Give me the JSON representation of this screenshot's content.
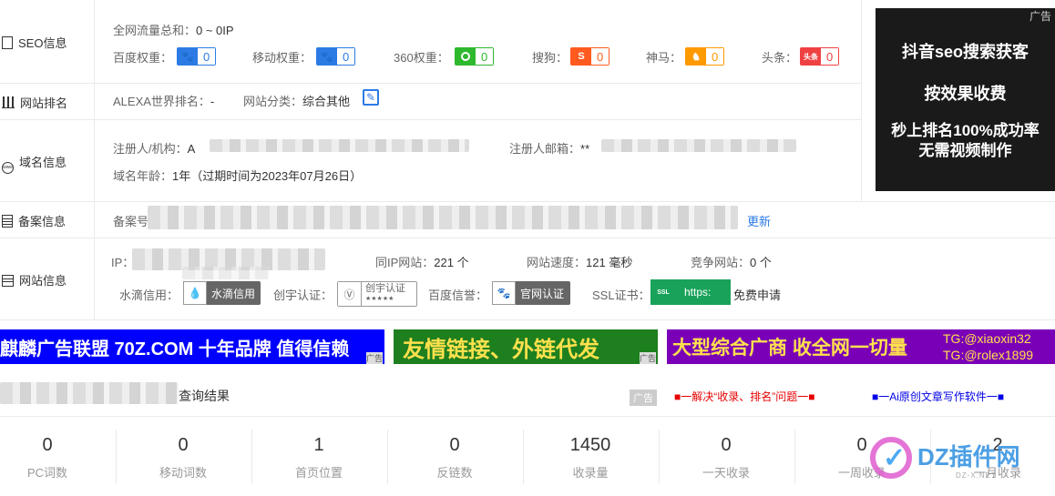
{
  "sections": {
    "seo": "SEO信息",
    "rank": "网站排名",
    "domain": "域名信息",
    "beian": "备案信息",
    "site": "网站信息"
  },
  "seo": {
    "traffic_label": "全网流量总和：",
    "traffic_value": "0 ~ 0IP",
    "baidu_label": "百度权重：",
    "baidu_value": "0",
    "mobile_label": "移动权重：",
    "mobile_value": "0",
    "s360_label": "360权重：",
    "s360_value": "0",
    "sogou_label": "搜狗：",
    "sogou_value": "0",
    "shenma_label": "神马：",
    "shenma_value": "0",
    "toutiao_label": "头条：",
    "toutiao_value": "0",
    "toutiao_icon_text": "头条"
  },
  "rank": {
    "alexa_label": "ALEXA世界排名：",
    "alexa_value": "-",
    "category_label": "网站分类：",
    "category_value": "综合其他"
  },
  "domain": {
    "registrant_label": "注册人/机构：",
    "registrant_value": "A",
    "email_label": "注册人邮箱：",
    "email_value": "**",
    "age_label": "域名年龄：",
    "age_value": "1年（过期时间为2023年07月26日）"
  },
  "beian": {
    "label": "备案号",
    "update_link": "更新"
  },
  "site": {
    "ip_label": "IP：",
    "same_ip_label": "同IP网站：",
    "same_ip_value": "221 个",
    "speed_label": "网站速度：",
    "speed_value": "121 毫秒",
    "competitor_label": "竞争网站：",
    "competitor_value": "0 个",
    "shuidi_label": "水滴信用：",
    "shuidi_cert": "水滴信用",
    "chuangyu_label": "创宇认证：",
    "chuangyu_cert": "创宇认证",
    "chuangyu_stars": "★★★★★",
    "baidu_credit_label": "百度信誉：",
    "baidu_credit_cert": "官网认证",
    "ssl_label": "SSL证书：",
    "ssl_badge": "SSL",
    "ssl_value": "https:",
    "ssl_apply": "免费申请"
  },
  "ad_box": {
    "tag": "广告",
    "line1": "抖音seo搜索获客",
    "line2": "按效果收费",
    "line3": "秒上排名100%成功率",
    "line4": "无需视频制作"
  },
  "banners": {
    "b1_text": "麒麟广告联盟 70Z.COM 十年品牌 值得信赖",
    "b1_tag": "广告",
    "b2_text": "友情链接、外链代发",
    "b2_tag": "广告",
    "b3_text": "大型综合广商 收全网一切量",
    "b3_tg1": "TG:@xiaoxin32",
    "b3_tg2": "TG:@rolex1899"
  },
  "results": {
    "title_suffix": "查询结果",
    "ad_tag": "广告",
    "link1": "■一解决“收录、排名”问题一■",
    "link2": "■一Ai原创文章写作软件一■"
  },
  "stats": [
    {
      "value": "0",
      "label": "PC词数"
    },
    {
      "value": "0",
      "label": "移动词数"
    },
    {
      "value": "1",
      "label": "首页位置"
    },
    {
      "value": "0",
      "label": "反链数"
    },
    {
      "value": "1450",
      "label": "收录量"
    },
    {
      "value": "0",
      "label": "一天收录"
    },
    {
      "value": "0",
      "label": "一周收录"
    },
    {
      "value": "2",
      "label": "一月收录"
    }
  ],
  "watermark": {
    "text": "DZ插件网",
    "sub": "DZ-X.NET"
  },
  "colors": {
    "blue": "#2c7be5",
    "green_badge": "#2eb82e",
    "orange": "#ff6600",
    "banner_blue": "#0000ff",
    "banner_green": "#1e7f1e",
    "banner_purple": "#7a00b8"
  }
}
